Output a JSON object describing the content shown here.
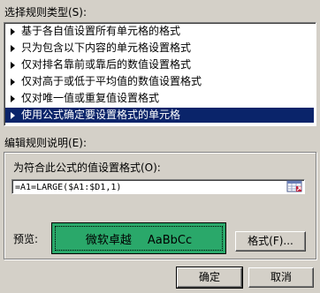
{
  "rule_type": {
    "label": "选择规则类型(S):",
    "items": [
      {
        "label": "基于各自值设置所有单元格的格式",
        "selected": false
      },
      {
        "label": "只为包含以下内容的单元格设置格式",
        "selected": false
      },
      {
        "label": "仅对排名靠前或靠后的数值设置格式",
        "selected": false
      },
      {
        "label": "仅对高于或低于平均值的数值设置格式",
        "selected": false
      },
      {
        "label": "仅对唯一值或重复值设置格式",
        "selected": false
      },
      {
        "label": "使用公式确定要设置格式的单元格",
        "selected": true
      }
    ]
  },
  "description": {
    "label": "编辑规则说明(E):",
    "formula_label": "为符合此公式的值设置格式(O):",
    "formula_value": "=A1=LARGE($A1:$D1,1)",
    "preview_label": "预览:",
    "preview_text_cjk": "微软卓越",
    "preview_text_latin": "AaBbCc",
    "preview_fill": "#2aa86a",
    "format_button": "格式(F)..."
  },
  "footer": {
    "ok_label": "确定",
    "cancel_label": "取消"
  }
}
